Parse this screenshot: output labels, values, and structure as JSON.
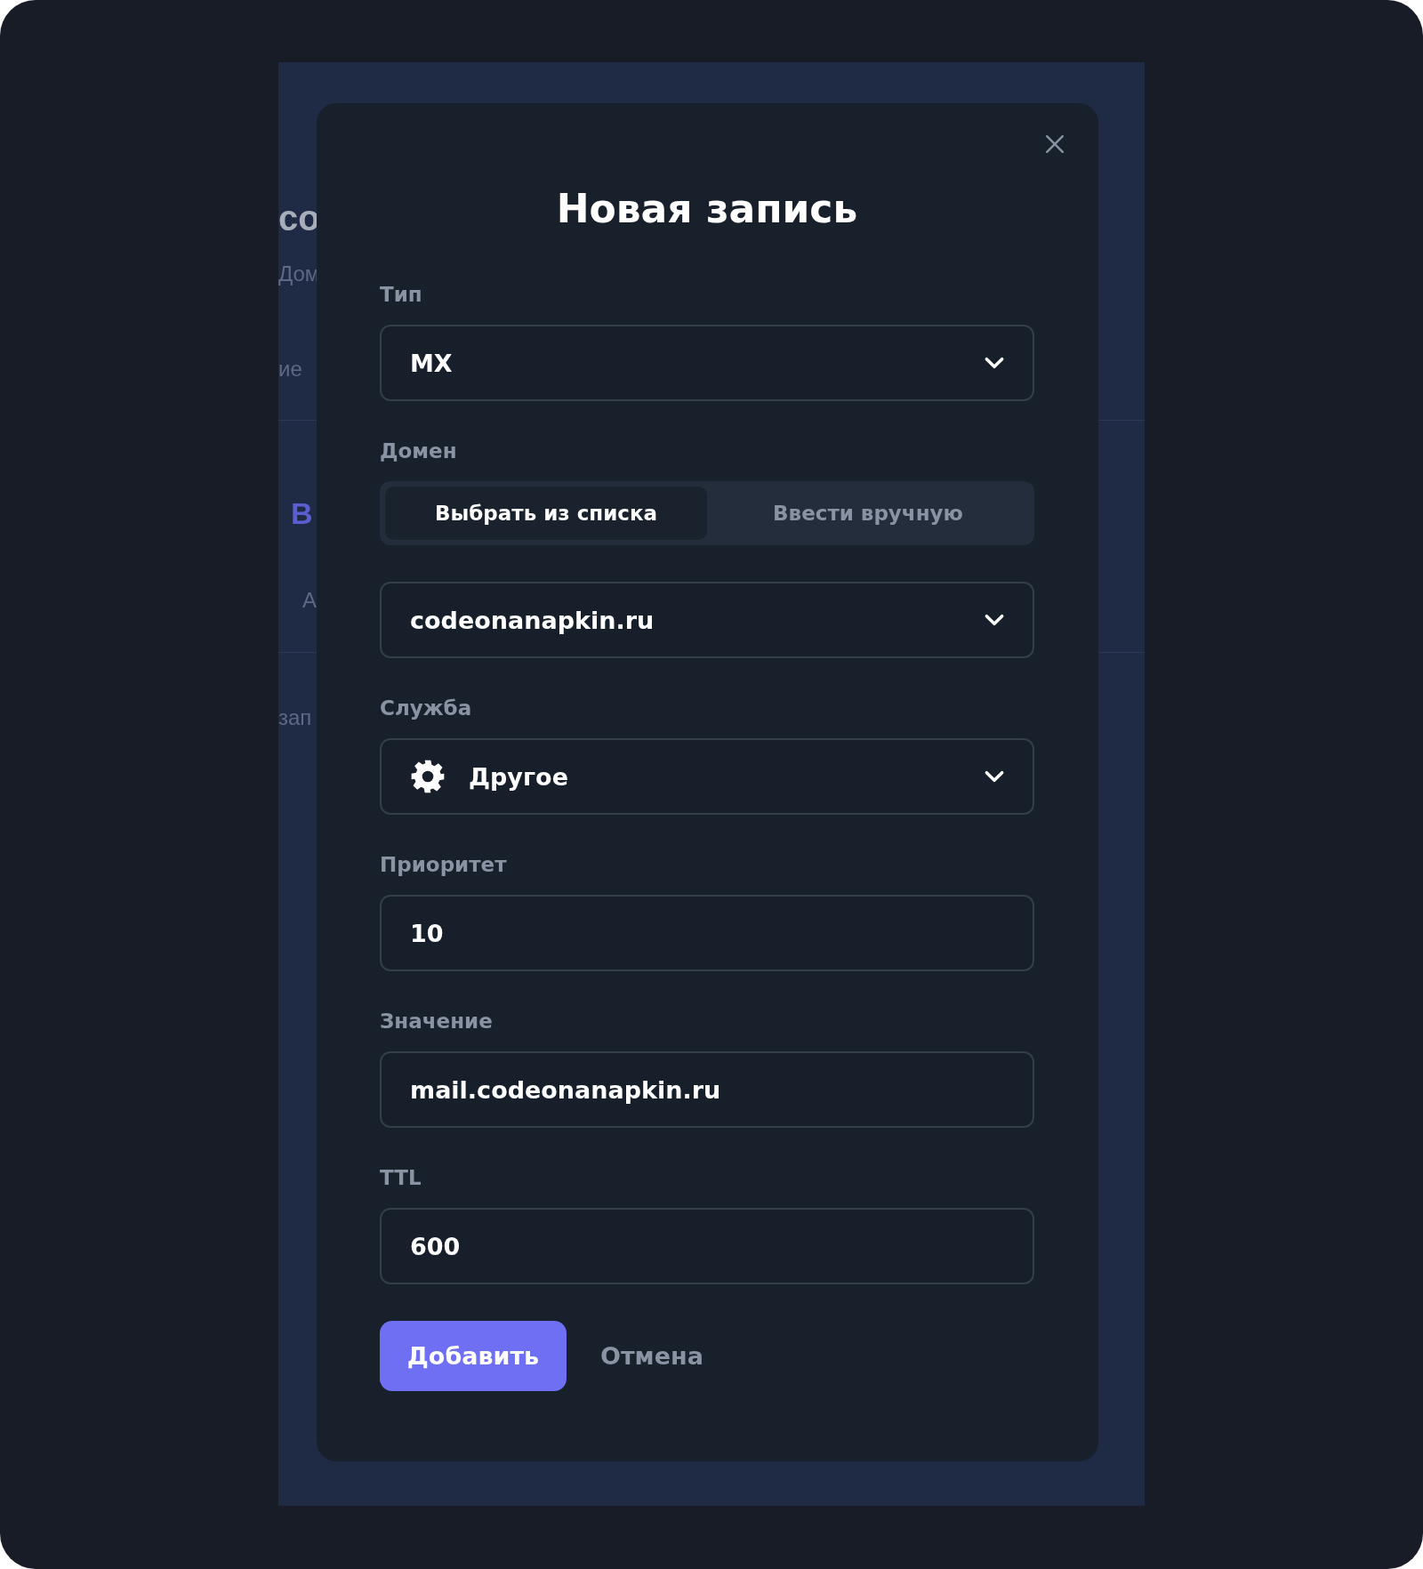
{
  "background_page": {
    "fragments": [
      {
        "kind": "heading",
        "text": "со"
      },
      {
        "kind": "breadcrumb",
        "text": "Дом"
      },
      {
        "kind": "text",
        "text": "ие"
      },
      {
        "kind": "divider"
      },
      {
        "kind": "active_tab",
        "text": "В"
      },
      {
        "kind": "tab",
        "text": "А"
      },
      {
        "kind": "divider"
      },
      {
        "kind": "text",
        "text": "зап"
      }
    ]
  },
  "dialog": {
    "title": "Новая запись",
    "fields": [
      {
        "kind": "select",
        "label": "Тип",
        "value": "MX"
      },
      {
        "kind": "segmented",
        "label": "Домен",
        "options": [
          {
            "label": "Выбрать из списка",
            "selected": true
          },
          {
            "label": "Ввести вручную",
            "selected": false
          }
        ]
      },
      {
        "kind": "select",
        "value": "codeonanapkin.ru"
      },
      {
        "kind": "select_icon",
        "label": "Служба",
        "value": "Другое"
      },
      {
        "kind": "input",
        "label": "Приоритет",
        "value": "10"
      },
      {
        "kind": "input",
        "label": "Значение",
        "value": "mail.codeonanapkin.ru"
      },
      {
        "kind": "input",
        "label": "TTL",
        "value": "600"
      }
    ],
    "buttons": [
      {
        "kind": "primary",
        "label": "Добавить"
      },
      {
        "kind": "secondary",
        "label": "Отмена"
      }
    ]
  }
}
